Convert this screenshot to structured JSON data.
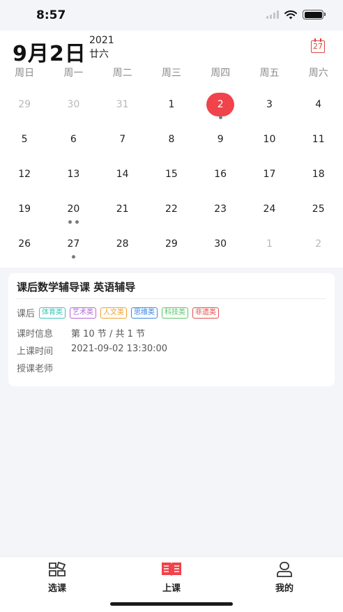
{
  "status": {
    "time": "8:57"
  },
  "header": {
    "big_date": "9月2日",
    "year": "2021",
    "lunar": "廿六",
    "today_icon_day": "27"
  },
  "weekdays": [
    "周日",
    "周一",
    "周二",
    "周三",
    "周四",
    "周五",
    "周六"
  ],
  "calendar": {
    "weeks": [
      [
        {
          "day": "29",
          "other": true
        },
        {
          "day": "30",
          "other": true
        },
        {
          "day": "31",
          "other": true
        },
        {
          "day": "1"
        },
        {
          "day": "2",
          "selected": true,
          "dots": 1
        },
        {
          "day": "3"
        },
        {
          "day": "4"
        }
      ],
      [
        {
          "day": "5"
        },
        {
          "day": "6"
        },
        {
          "day": "7"
        },
        {
          "day": "8"
        },
        {
          "day": "9"
        },
        {
          "day": "10"
        },
        {
          "day": "11"
        }
      ],
      [
        {
          "day": "12"
        },
        {
          "day": "13"
        },
        {
          "day": "14"
        },
        {
          "day": "15"
        },
        {
          "day": "16"
        },
        {
          "day": "17"
        },
        {
          "day": "18"
        }
      ],
      [
        {
          "day": "19"
        },
        {
          "day": "20",
          "dots": 2
        },
        {
          "day": "21"
        },
        {
          "day": "22"
        },
        {
          "day": "23"
        },
        {
          "day": "24"
        },
        {
          "day": "25"
        }
      ],
      [
        {
          "day": "26"
        },
        {
          "day": "27",
          "dots": 1
        },
        {
          "day": "28"
        },
        {
          "day": "29"
        },
        {
          "day": "30"
        },
        {
          "day": "1",
          "other": true
        },
        {
          "day": "2",
          "other": true
        }
      ]
    ]
  },
  "course": {
    "title": "课后数学辅导课  英语辅导",
    "tag_label": "课后",
    "tags": [
      {
        "text": "体育类",
        "color": "#3cc4b8"
      },
      {
        "text": "艺术类",
        "color": "#b266d6"
      },
      {
        "text": "人文类",
        "color": "#f0a02a"
      },
      {
        "text": "思维类",
        "color": "#3a86e0"
      },
      {
        "text": "科技类",
        "color": "#5cc46a"
      },
      {
        "text": "非遗类",
        "color": "#e0504a"
      }
    ],
    "info": [
      {
        "key": "课时信息",
        "value": "第 10 节 / 共 1 节"
      },
      {
        "key": "上课时间",
        "value": "2021-09-02 13:30:00"
      },
      {
        "key": "授课老师",
        "value": ""
      }
    ]
  },
  "nav": {
    "items": [
      {
        "label": "选课",
        "icon": "course-select-icon"
      },
      {
        "label": "上课",
        "icon": "open-book-icon",
        "active": true
      },
      {
        "label": "我的",
        "icon": "profile-icon"
      }
    ]
  },
  "colors": {
    "accent": "#f0434b"
  }
}
